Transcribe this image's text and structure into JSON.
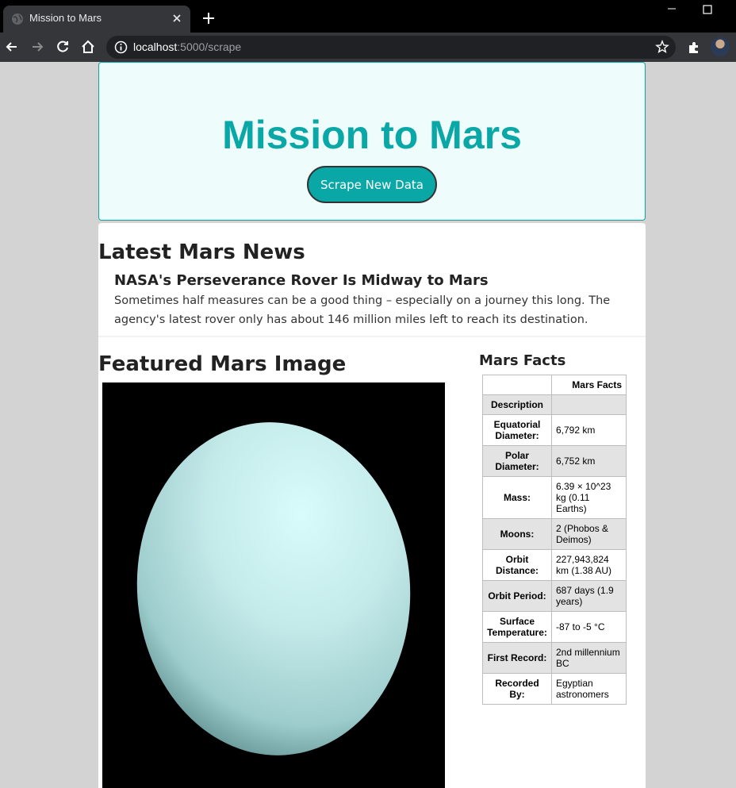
{
  "browser": {
    "tab_title": "Mission to Mars",
    "url_host": "localhost",
    "url_path": ":5000/scrape"
  },
  "header": {
    "title": "Mission to Mars",
    "scrape_button": "Scrape New Data"
  },
  "news": {
    "heading": "Latest Mars News",
    "title": "NASA's Perseverance Rover Is Midway to Mars",
    "teaser": "Sometimes half measures can be a good thing – especially on a journey this long. The agency's latest rover only has about 146 million miles left to reach its destination."
  },
  "featured": {
    "heading": "Featured Mars Image"
  },
  "facts": {
    "heading": "Mars Facts",
    "column_header": "Mars Facts",
    "description_label": "Description",
    "description_value": "",
    "rows": [
      {
        "label": "Equatorial Diameter:",
        "value": "6,792 km"
      },
      {
        "label": "Polar Diameter:",
        "value": "6,752 km"
      },
      {
        "label": "Mass:",
        "value": "6.39 × 10^23 kg (0.11 Earths)"
      },
      {
        "label": "Moons:",
        "value": "2 (Phobos & Deimos)"
      },
      {
        "label": "Orbit Distance:",
        "value": "227,943,824 km (1.38 AU)"
      },
      {
        "label": "Orbit Period:",
        "value": "687 days (1.9 years)"
      },
      {
        "label": "Surface Temperature:",
        "value": "-87 to -5 °C"
      },
      {
        "label": "First Record:",
        "value": "2nd millennium BC"
      },
      {
        "label": "Recorded By:",
        "value": "Egyptian astronomers"
      }
    ]
  }
}
